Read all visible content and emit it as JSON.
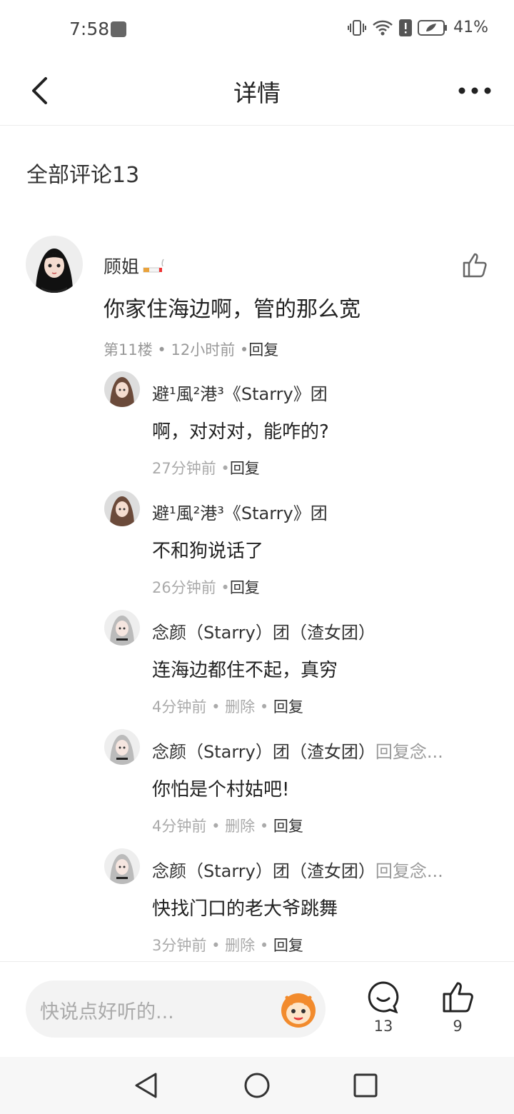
{
  "status_bar": {
    "time": "7:58",
    "battery": "41%"
  },
  "header": {
    "title": "详情"
  },
  "section": {
    "title": "全部评论13"
  },
  "main_comment": {
    "user": "顾姐",
    "text": "你家住海边啊，管的那么宽",
    "floor": "第11楼",
    "time": "12小时前",
    "reply_label": "回复"
  },
  "replies": [
    {
      "user": "避¹風²港³《Starry》团",
      "reply_to": "",
      "text": "啊，对对对，能咋的?",
      "time": "27分钟前",
      "delete_label": "",
      "reply_label": "回复"
    },
    {
      "user": "避¹風²港³《Starry》团",
      "reply_to": "",
      "text": "不和狗说话了",
      "time": "26分钟前",
      "delete_label": "",
      "reply_label": "回复"
    },
    {
      "user": "念颜（Starry）团（渣女团）",
      "reply_to": "",
      "text": "连海边都住不起，真穷",
      "time": "4分钟前",
      "delete_label": "删除",
      "reply_label": "回复"
    },
    {
      "user": "念颜（Starry）团（渣女团）",
      "reply_to": "回复念...",
      "text": "你怕是个村姑吧!",
      "time": "4分钟前",
      "delete_label": "删除",
      "reply_label": "回复"
    },
    {
      "user": "念颜（Starry）团（渣女团）",
      "reply_to": "回复念...",
      "text": "快找门口的老大爷跳舞",
      "time": "3分钟前",
      "delete_label": "删除",
      "reply_label": "回复"
    }
  ],
  "bottom_bar": {
    "input_placeholder": "快说点好听的...",
    "comment_count": "13",
    "like_count": "9"
  }
}
